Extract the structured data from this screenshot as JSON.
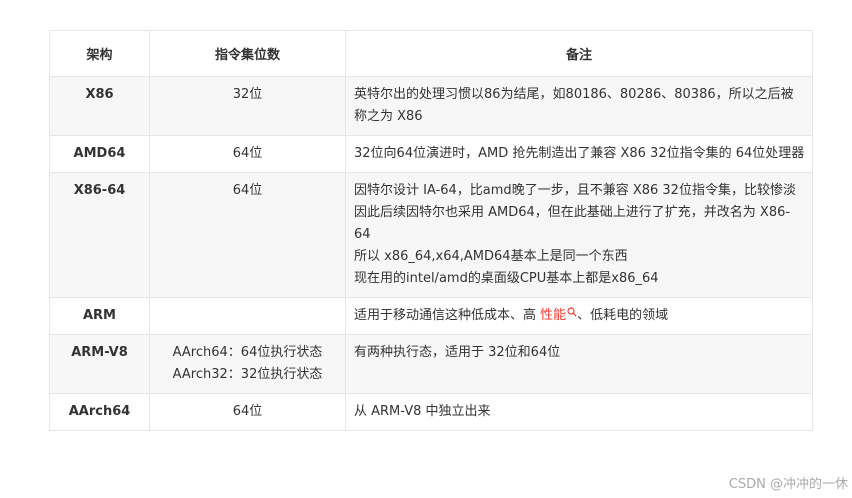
{
  "table": {
    "headers": [
      "架构",
      "指令集位数",
      "备注"
    ],
    "rows": [
      {
        "arch": "X86",
        "bits": [
          "32位"
        ],
        "notes": [
          "英特尔出的处理习惯以86为结尾，如80186、80286、80386，所以之后被称之为 X86"
        ]
      },
      {
        "arch": "AMD64",
        "bits": [
          "64位"
        ],
        "notes": [
          "32位向64位演进时，AMD 抢先制造出了兼容 X86 32位指令集的 64位处理器"
        ]
      },
      {
        "arch": "X86-64",
        "bits": [
          "64位"
        ],
        "notes": [
          "因特尔设计 IA-64，比amd晚了一步，且不兼容 X86 32位指令集，比较惨淡",
          "因此后续因特尔也采用 AMD64，但在此基础上进行了扩充，并改名为 X86-64",
          "所以 x86_64,x64,AMD64基本上是同一个东西",
          "现在用的intel/amd的桌面级CPU基本上都是x86_64"
        ]
      },
      {
        "arch": "ARM",
        "bits": [],
        "notes_prefix": "适用于移动通信这种低成本、高 ",
        "notes_link": "性能",
        "notes_suffix": "、低耗电的领域"
      },
      {
        "arch": "ARM-V8",
        "bits": [
          "AArch64：64位执行状态",
          "AArch32：32位执行状态"
        ],
        "notes": [
          "有两种执行态，适用于 32位和64位"
        ]
      },
      {
        "arch": "AArch64",
        "bits": [
          "64位"
        ],
        "notes": [
          "从 ARM-V8 中独立出来"
        ]
      }
    ]
  },
  "watermark": "CSDN @冲冲的一休",
  "colors": {
    "link": "#f5372c",
    "alt_row": "#f7f7f7",
    "border": "#e6e6e6"
  }
}
